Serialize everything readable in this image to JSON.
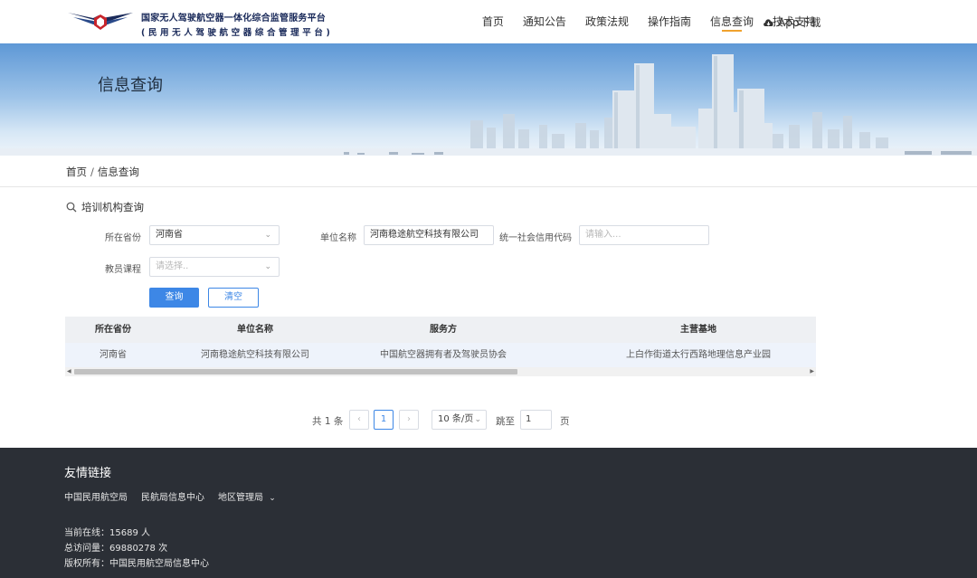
{
  "header": {
    "logo_line1": "国家无人驾驶航空器一体化综合监管服务平台",
    "logo_line2": "(民用无人驾驶航空器综合管理平台)",
    "nav": [
      "首页",
      "通知公告",
      "政策法规",
      "操作指南",
      "信息查询",
      "技术支持"
    ],
    "active_nav": "信息查询",
    "app_download": "App下载",
    "brand_red": "#c8242b",
    "brand_navy": "#1a2a5a"
  },
  "banner": {
    "title": "信息查询"
  },
  "breadcrumb": {
    "home": "首页",
    "separator": "/",
    "current": "信息查询"
  },
  "query": {
    "section_title": "培训机构查询",
    "province_label": "所在省份",
    "province_value": "河南省",
    "unit_label": "单位名称",
    "unit_value": "河南稳途航空科技有限公司",
    "credit_label": "统一社会信用代码",
    "credit_placeholder": "请输入...",
    "course_label": "教员课程",
    "course_placeholder": "请选择..",
    "search_button": "查询",
    "clear_button": "清空"
  },
  "table": {
    "headers": [
      "所在省份",
      "单位名称",
      "服务方",
      "主营基地"
    ],
    "rows": [
      [
        "河南省",
        "河南稳途航空科技有限公司",
        "中国航空器拥有者及驾驶员协会",
        "上白作街道太行西路地理信息产业园"
      ]
    ]
  },
  "pagination": {
    "total_text": "共 1 条",
    "current_page": "1",
    "page_size": "10 条/页",
    "jump_label": "跳至",
    "jump_value": "1",
    "page_suffix": "页",
    "prev": "‹",
    "next": "›"
  },
  "footer": {
    "title": "友情链接",
    "links": [
      "中国民用航空局",
      "民航局信息中心",
      "地区管理局"
    ],
    "online": "当前在线：15689 人",
    "visits": "总访问量：69880278 次",
    "copyright": "版权所有：中国民用航空局信息中心"
  },
  "colors": {
    "accent": "#3d87e6",
    "active_underline": "#f0a22e",
    "footer_bg": "#2b2f36"
  }
}
